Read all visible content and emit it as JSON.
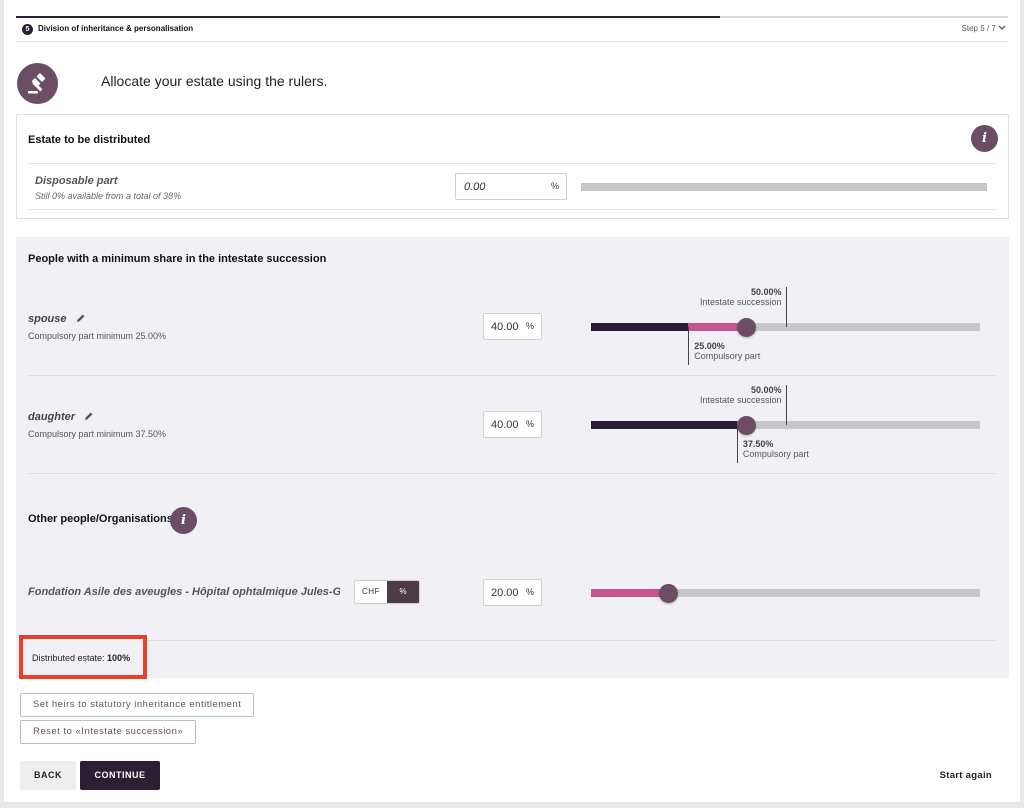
{
  "header": {
    "step_number": "5",
    "step_title": "Division of inheritance & personalisation",
    "step_count": "Step 5 / 7",
    "progress_fraction": 0.71
  },
  "hero": {
    "icon": "gavel-icon",
    "title": "Allocate your estate using the rulers."
  },
  "estate": {
    "title": "Estate to be distributed",
    "info_glyph": "i",
    "disposable": {
      "label": "Disposable part",
      "sub": "Still 0% available from a total of 38%",
      "value": "0.00",
      "unit": "%"
    }
  },
  "heirs": {
    "title": "People with a minimum share in the intestate succession",
    "rows": [
      {
        "name": "spouse",
        "sub": "Compulsory part minimum 25.00%",
        "value": "40.00",
        "unit": "%",
        "share": 40,
        "compulsory": 25,
        "intestate": 50,
        "intestate_value": "50.00%",
        "intestate_label": "Intestate succession",
        "compulsory_value": "25.00%",
        "compulsory_label": "Compulsory part"
      },
      {
        "name": "daughter",
        "sub": "Compulsory part minimum 37.50%",
        "value": "40.00",
        "unit": "%",
        "share": 40,
        "compulsory": 37.5,
        "intestate": 50,
        "intestate_value": "50.00%",
        "intestate_label": "Intestate succession",
        "compulsory_value": "37.50%",
        "compulsory_label": "Compulsory part"
      }
    ]
  },
  "others": {
    "title": "Other people/Organisations",
    "info_glyph": "i",
    "rows": [
      {
        "name": "Fondation Asile des aveugles - Hôpital ophtalmique Jules-Go...",
        "toggle_chf": "CHF",
        "toggle_pct": "%",
        "value": "20.00",
        "unit": "%",
        "share": 20
      }
    ]
  },
  "distributed": {
    "label": "Distributed estate: ",
    "value": "100%"
  },
  "actions": {
    "statutory": "Set heirs to statutory inheritance entitlement",
    "reset": "Reset to «Intestate succession»",
    "back": "BACK",
    "continue": "CONTINUE",
    "start_again": "Start again"
  },
  "colors": {
    "primary": "#2a1f33",
    "accent": "#6b4e63",
    "pink": "#c4568e",
    "highlight": "#e8402b"
  }
}
